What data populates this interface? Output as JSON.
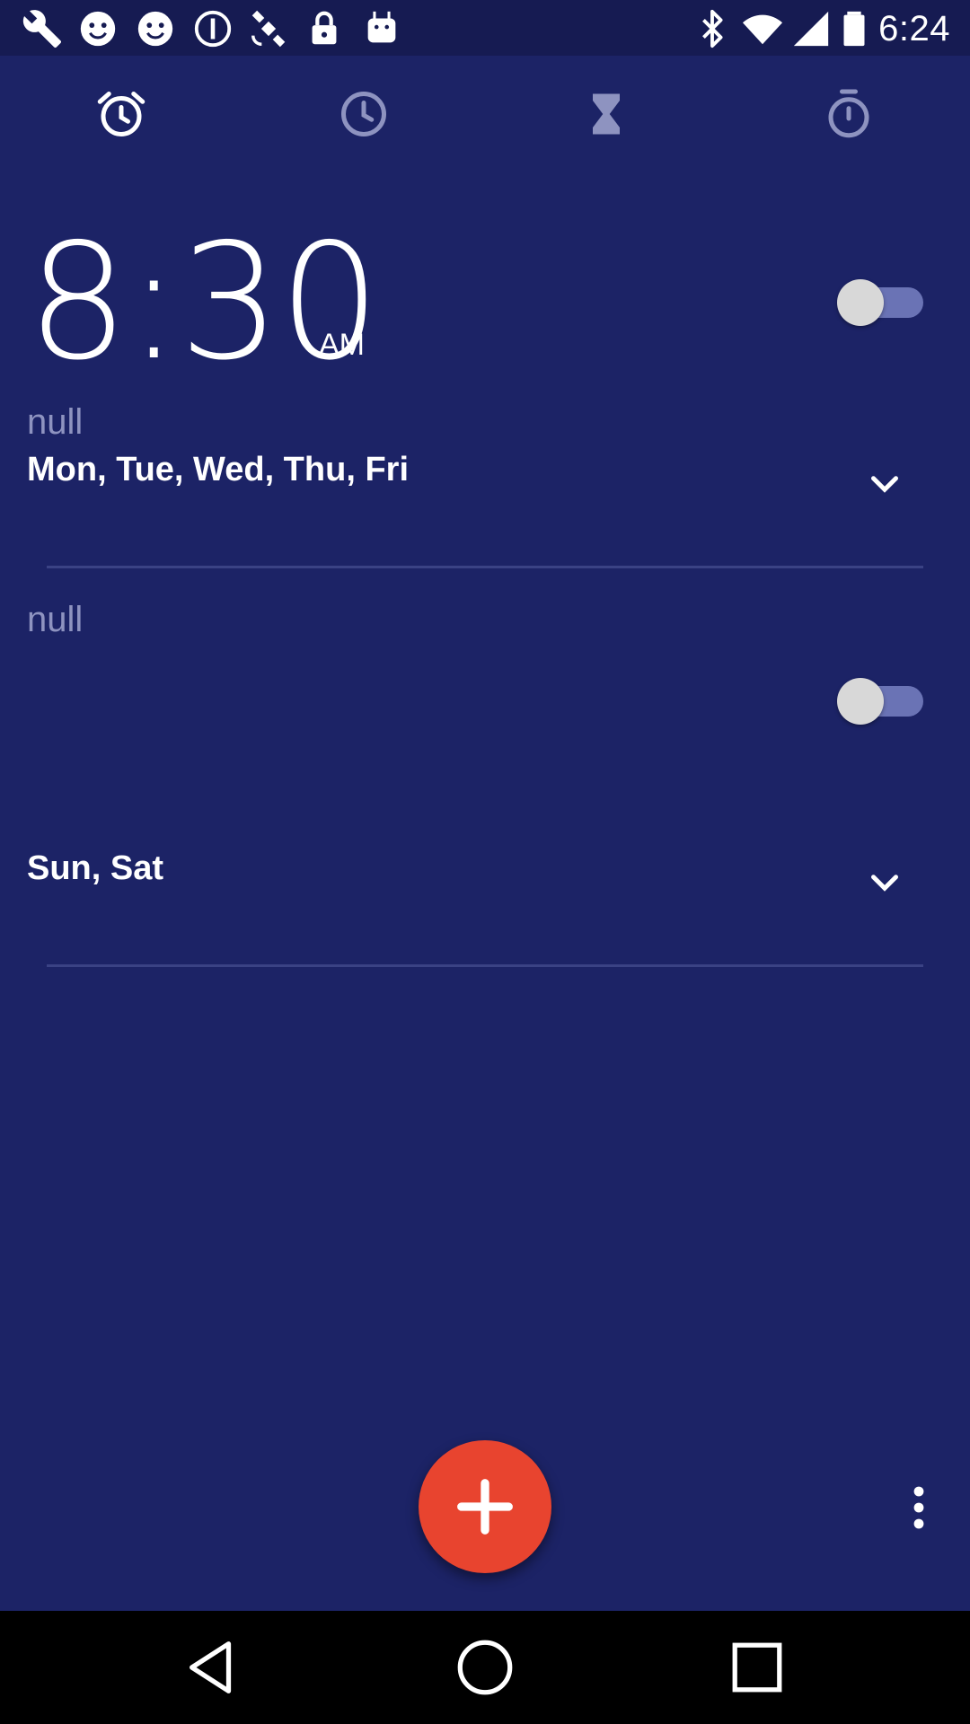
{
  "status_bar": {
    "time": "6:24",
    "icons": [
      "wrench-icon",
      "smiley-icon",
      "smiley-icon",
      "info-icon",
      "satellite-icon",
      "lock-icon",
      "android-icon",
      "bluetooth-icon",
      "wifi-icon",
      "signal-icon",
      "battery-icon"
    ]
  },
  "tabs": [
    {
      "name": "alarm-tab",
      "icon": "alarm-clock-icon"
    },
    {
      "name": "clock-tab",
      "icon": "clock-icon"
    },
    {
      "name": "timer-tab",
      "icon": "hourglass-icon"
    },
    {
      "name": "stopwatch-tab",
      "icon": "stopwatch-icon"
    }
  ],
  "alarms": [
    {
      "time": "8:30",
      "period": "AM",
      "label": "null",
      "days": "Mon, Tue, Wed, Thu, Fri",
      "enabled": false
    },
    {
      "label": "null",
      "days": "Sun, Sat",
      "enabled": false
    }
  ],
  "colors": {
    "background": "#1c2366",
    "status_bar": "#161b52",
    "accent_fab": "#e8442f",
    "muted_text": "#8e93c0"
  },
  "fab": {
    "icon": "plus-icon"
  },
  "overflow": {
    "icon": "more-vert-icon"
  },
  "nav_bar": [
    "back-icon",
    "home-icon",
    "recents-icon"
  ]
}
